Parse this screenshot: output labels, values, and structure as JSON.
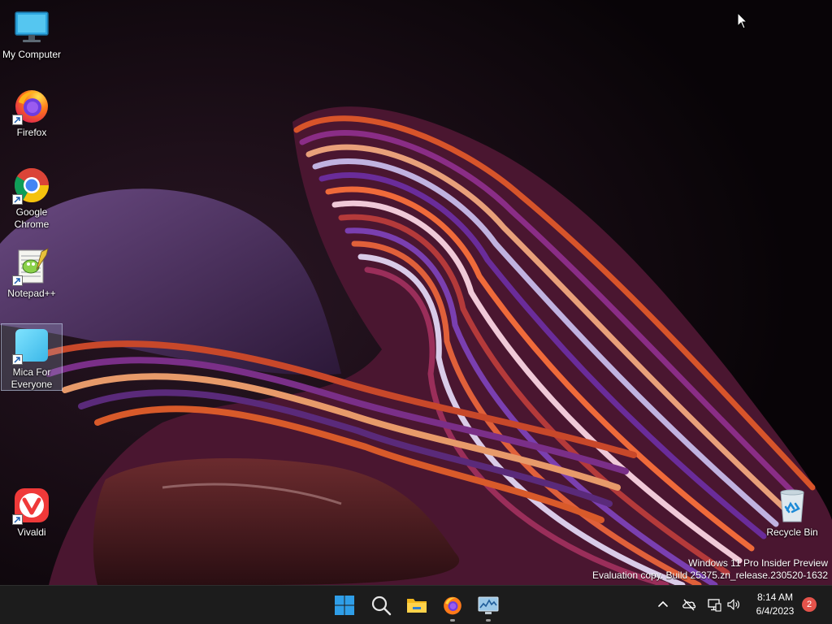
{
  "desktop": {
    "icons": [
      {
        "label": "My Computer",
        "icon": "monitor-icon",
        "shortcut": false
      },
      {
        "label": "Firefox",
        "icon": "firefox-icon",
        "shortcut": true
      },
      {
        "label": "Google Chrome",
        "icon": "chrome-icon",
        "shortcut": true
      },
      {
        "label": "Notepad++",
        "icon": "notepadpp-icon",
        "shortcut": true
      },
      {
        "label": "Mica For Everyone",
        "icon": "mica-icon",
        "shortcut": true,
        "selected": true
      },
      {
        "label": "Vivaldi",
        "icon": "vivaldi-icon",
        "shortcut": true
      },
      {
        "label": "Recycle Bin",
        "icon": "recycle-bin-icon",
        "shortcut": false
      }
    ],
    "watermark": {
      "line1": "Windows 11 Pro Insider Preview",
      "line2": "Evaluation copy. Build 25375.zn_release.230520-1632"
    }
  },
  "taskbar": {
    "apps": [
      {
        "name": "Start",
        "icon": "windows-start-icon",
        "running": false
      },
      {
        "name": "Search",
        "icon": "search-icon",
        "running": false
      },
      {
        "name": "File Explorer",
        "icon": "folder-icon",
        "running": false
      },
      {
        "name": "Firefox",
        "icon": "firefox-icon",
        "running": true
      },
      {
        "name": "Resource Monitor",
        "icon": "monitor-chart-icon",
        "running": true
      }
    ],
    "tray": {
      "icons": [
        "chevron-up-icon",
        "cloud-off-icon",
        "network-icon",
        "volume-icon"
      ],
      "time": "8:14 AM",
      "date": "6/4/2023",
      "notifications": "2"
    }
  },
  "colors": {
    "taskbar_bg": "#1c1c1c",
    "badge": "#e5534b",
    "desktop_bg": "#0b0609"
  }
}
